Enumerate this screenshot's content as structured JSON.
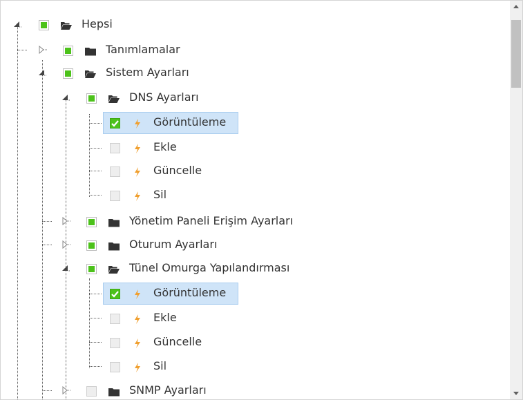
{
  "colors": {
    "check_green": "#4cc21a",
    "selection_bg": "#cfe4f8",
    "leaf_icon": "#f0a030",
    "folder_icon": "#333333"
  },
  "tree": {
    "root": {
      "label": "Hepsi",
      "state": "partial",
      "expanded": true
    },
    "tanimlamalar": {
      "label": "Tanımlamalar",
      "state": "partial",
      "expanded": false
    },
    "sistem": {
      "label": "Sistem Ayarları",
      "state": "partial",
      "expanded": true
    },
    "dns": {
      "label": "DNS Ayarları",
      "state": "partial",
      "expanded": true
    },
    "dns_children": [
      {
        "label": "Görüntüleme",
        "state": "checked",
        "selected": true
      },
      {
        "label": "Ekle",
        "state": "unchecked"
      },
      {
        "label": "Güncelle",
        "state": "unchecked"
      },
      {
        "label": "Sil",
        "state": "unchecked"
      }
    ],
    "yonetim": {
      "label": "Yönetim Paneli Erişim Ayarları",
      "state": "partial",
      "expanded": false
    },
    "oturum": {
      "label": "Oturum Ayarları",
      "state": "partial",
      "expanded": false
    },
    "tunel": {
      "label": "Tünel Omurga Yapılandırması",
      "state": "partial",
      "expanded": true
    },
    "tunel_children": [
      {
        "label": "Görüntüleme",
        "state": "checked",
        "selected": true
      },
      {
        "label": "Ekle",
        "state": "unchecked"
      },
      {
        "label": "Güncelle",
        "state": "unchecked"
      },
      {
        "label": "Sil",
        "state": "unchecked"
      }
    ],
    "snmp": {
      "label": "SNMP Ayarları",
      "state": "unchecked",
      "expanded": false
    }
  },
  "icons": {
    "open_folder": "folder-open-icon",
    "closed_folder": "folder-icon",
    "leaf": "bolt-icon"
  }
}
